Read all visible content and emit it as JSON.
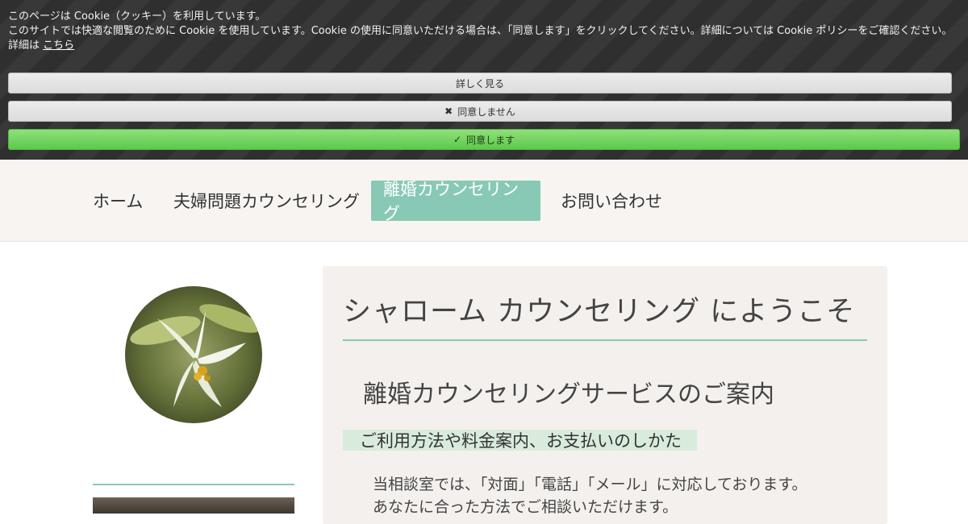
{
  "cookie": {
    "line1": "このページは Cookie（クッキー）を利用しています。",
    "line2": "このサイトでは快適な閲覧のために Cookie を使用しています。Cookie の使用に同意いただける場合は、「同意します」をクリックしてください。詳細については Cookie ポリシーをご確認ください。",
    "detail_prefix": "詳細は",
    "detail_link": "こちら",
    "more_label": "詳しく見る",
    "decline_label": "同意しません",
    "accept_label": "同意します",
    "decline_icon": "✖",
    "accept_icon": "✓"
  },
  "nav": {
    "items": [
      {
        "label": "ホーム",
        "active": false
      },
      {
        "label": "夫婦問題カウンセリング",
        "active": false
      },
      {
        "label": "離婚カウンセリング",
        "active": true
      },
      {
        "label": "お問い合わせ",
        "active": false
      }
    ],
    "active_color": "#88c9b5"
  },
  "main": {
    "title": "シャローム カウンセリング にようこそ",
    "subtitle": "離婚カウンセリングサービスのご案内",
    "highlight": "ご利用方法や料金案内、お支払いのしかた",
    "body_lines": [
      "当相談室では、「対面」「電話」「メール」に対応しております。",
      "あなたに合った方法でご相談いただけます。"
    ]
  },
  "colors": {
    "accent": "#88c9b5",
    "accept_green": "#5cc94a",
    "content_bg": "#f4f0ed"
  }
}
